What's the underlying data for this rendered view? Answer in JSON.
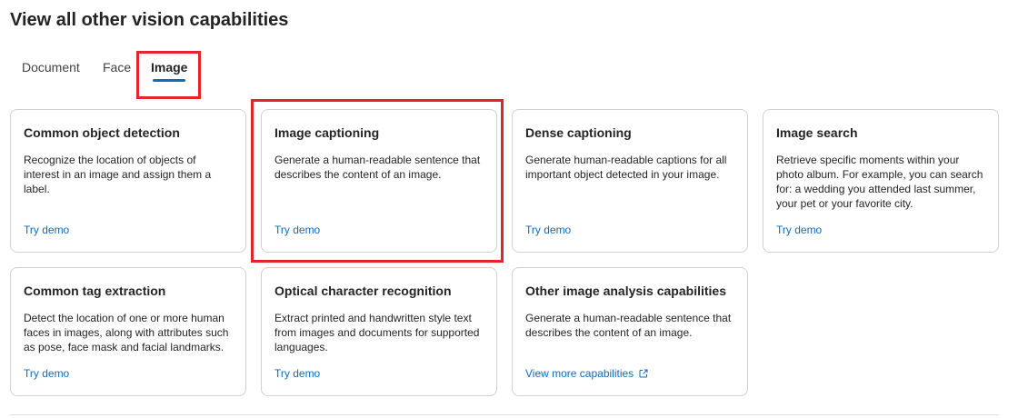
{
  "page": {
    "title": "View all other vision capabilities"
  },
  "tabs": [
    {
      "label": "Document",
      "active": false
    },
    {
      "label": "Face",
      "active": false
    },
    {
      "label": "Image",
      "active": true
    }
  ],
  "cards": [
    {
      "title": "Common object detection",
      "description": "Recognize the location of objects of interest in an image and assign them a label.",
      "link": "Try demo"
    },
    {
      "title": "Image captioning",
      "description": "Generate a human-readable sentence that describes the content of an image.",
      "link": "Try demo"
    },
    {
      "title": "Dense captioning",
      "description": "Generate human-readable captions for all important object detected in your image.",
      "link": "Try demo"
    },
    {
      "title": "Image search",
      "description": "Retrieve specific moments within your photo album. For example, you can search for: a wedding you attended last summer, your pet or your favorite city.",
      "link": "Try demo"
    },
    {
      "title": "Common tag extraction",
      "description": "Detect the location of one or more human faces in images, along with attributes such as pose, face mask and facial landmarks.",
      "link": "Try demo"
    },
    {
      "title": "Optical character recognition",
      "description": "Extract printed and handwritten style text from images and documents for supported languages.",
      "link": "Try demo"
    },
    {
      "title": "Other image analysis capabilities",
      "description": "Generate a human-readable sentence that describes the content of an image.",
      "link": "View more capabilities",
      "link_icon": "external-link-icon"
    }
  ],
  "colors": {
    "accent": "#0f6cbd",
    "highlight": "#e3242b",
    "border": "#d1d1d1"
  }
}
